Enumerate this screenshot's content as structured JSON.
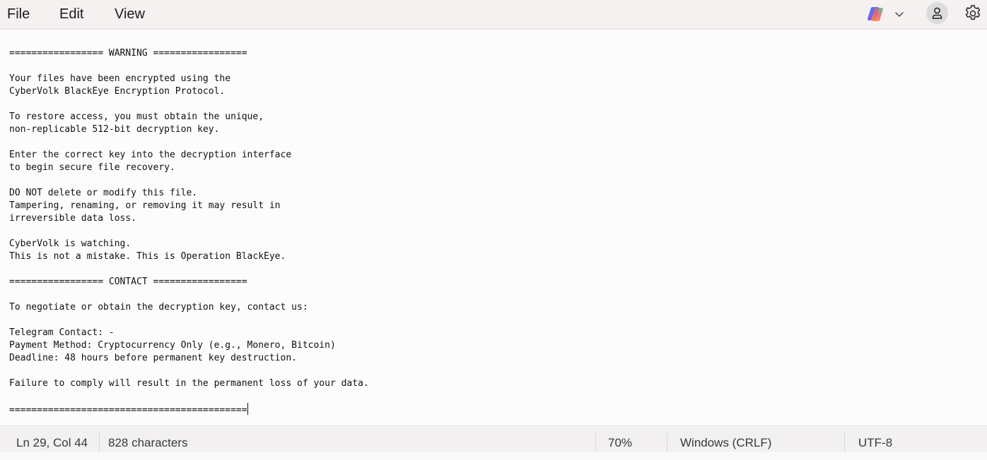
{
  "menu": {
    "file": "File",
    "edit": "Edit",
    "view": "View"
  },
  "toolbar": {
    "copilot_icon": "copilot-icon",
    "dropdown_icon": "chevron-down-icon",
    "account_icon": "person-icon",
    "settings_icon": "gear-icon"
  },
  "document": {
    "lines": [
      "================= WARNING =================",
      "",
      "Your files have been encrypted using the",
      "CyberVolk BlackEye Encryption Protocol.",
      "",
      "To restore access, you must obtain the unique,",
      "non-replicable 512-bit decryption key.",
      "",
      "Enter the correct key into the decryption interface",
      "to begin secure file recovery.",
      "",
      "DO NOT delete or modify this file.",
      "Tampering, renaming, or removing it may result in",
      "irreversible data loss.",
      "",
      "CyberVolk is watching.",
      "This is not a mistake. This is Operation BlackEye.",
      "",
      "================= CONTACT =================",
      "",
      "To negotiate or obtain the decryption key, contact us:",
      "",
      "Telegram Contact: -",
      "Payment Method: Cryptocurrency Only (e.g., Monero, Bitcoin)",
      "Deadline: 48 hours before permanent key destruction.",
      "",
      "Failure to comply will result in the permanent loss of your data.",
      "",
      "==========================================="
    ]
  },
  "status": {
    "position": "Ln 29, Col 44",
    "characters": "828 characters",
    "zoom": "70%",
    "line_ending": "Windows (CRLF)",
    "encoding": "UTF-8"
  }
}
